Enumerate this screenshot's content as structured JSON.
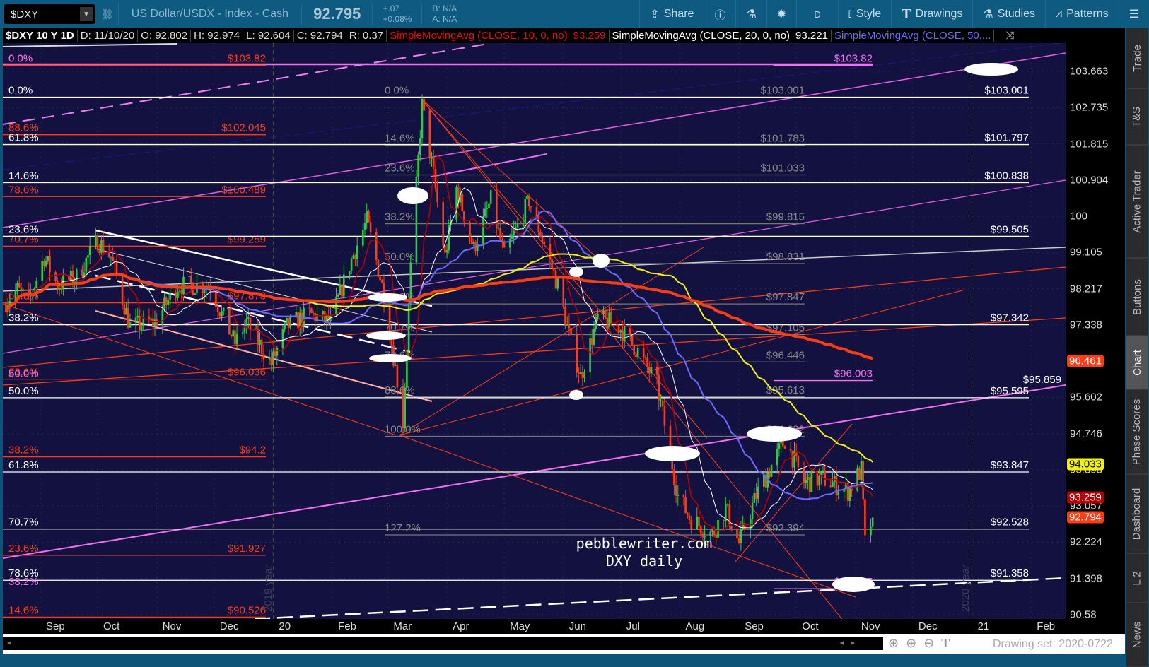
{
  "toolbar": {
    "symbol": "$DXY",
    "description": "US Dollar/USDX - Index - Cash",
    "last": "92.795",
    "change": "+.07",
    "change_pct": "+0.08%",
    "bid": "B: N/A",
    "ask": "A: N/A",
    "share": "Share",
    "interval": "D",
    "style": "Style",
    "drawings": "Drawings",
    "studies": "Studies",
    "patterns": "Patterns"
  },
  "infobar": {
    "title": "$DXY 10 Y 1D",
    "date": "D: 11/10/20",
    "open": "O: 92.802",
    "high": "H: 92.974",
    "low": "L: 92.604",
    "close": "C: 92.794",
    "range": "R: 0.37",
    "sma10": "SimpleMovingAvg (CLOSE, 10, 0, no)",
    "sma10_val": "93.259",
    "sma20": "SimpleMovingAvg (CLOSE, 20, 0, no)",
    "sma20_val": "93.221",
    "sma50": "SimpleMovingAvg (CLOSE, 50,..."
  },
  "sidebar": {
    "tabs": [
      "Trade",
      "T&S",
      "Active Trader",
      "Buttons",
      "Chart",
      "Phase Scores",
      "Dashboard",
      "L 2",
      "News"
    ],
    "active": "Chart"
  },
  "bottom": {
    "drawing_set": "Drawing set: 2020-0722"
  },
  "watermark": {
    "line1": "pebblewriter.com",
    "line2": "DXY daily",
    "year1": "2019 year",
    "year2": "2020 year"
  },
  "colors": {
    "up": "#2ecc40",
    "down": "#ff3d14",
    "sma10": "#b40000",
    "sma20": "#ffffff",
    "sma50": "#6b6bff",
    "sma100": "#f2f20a",
    "sma200": "#ff3d14",
    "bg": "#13113f"
  },
  "chart_data": {
    "type": "candlestick",
    "scale": "log",
    "ylim": [
      90.58,
      103.663
    ],
    "y_ticks": [
      "103.663",
      "102.735",
      "101.815",
      "100.904",
      "100",
      "99.105",
      "98.217",
      "97.338",
      "95.602",
      "94.746",
      "93.898",
      "93.057",
      "92.224",
      "91.398",
      "90.58"
    ],
    "x_ticks": [
      {
        "label": "Sep",
        "date": "2019-09-01"
      },
      {
        "label": "Oct",
        "date": "2019-10-01"
      },
      {
        "label": "Nov",
        "date": "2019-11-01"
      },
      {
        "label": "Dec",
        "date": "2019-12-01"
      },
      {
        "label": "20",
        "date": "2020-01-01"
      },
      {
        "label": "Feb",
        "date": "2020-02-01"
      },
      {
        "label": "Mar",
        "date": "2020-03-01"
      },
      {
        "label": "Apr",
        "date": "2020-04-01"
      },
      {
        "label": "May",
        "date": "2020-05-01"
      },
      {
        "label": "Jun",
        "date": "2020-06-01"
      },
      {
        "label": "Jul",
        "date": "2020-07-01"
      },
      {
        "label": "Aug",
        "date": "2020-08-01"
      },
      {
        "label": "Sep",
        "date": "2020-09-01"
      },
      {
        "label": "Oct",
        "date": "2020-10-01"
      },
      {
        "label": "Nov",
        "date": "2020-11-01"
      },
      {
        "label": "Dec",
        "date": "2020-12-01"
      },
      {
        "label": "21",
        "date": "2021-01-01"
      },
      {
        "label": "Feb",
        "date": "2021-02-01"
      }
    ],
    "price_tags": [
      {
        "value": "96.461",
        "color": "#ff3d14",
        "text": "#fff"
      },
      {
        "value": "94.033",
        "color": "#f2f20a",
        "text": "#000"
      },
      {
        "value": "93.259",
        "color": "#b40000",
        "text": "#fff"
      },
      {
        "value": "92.794",
        "color": "#ff3d14",
        "text": "#fff"
      }
    ],
    "close_keypoints": [
      [
        "2019-08-14",
        97.9
      ],
      [
        "2019-08-20",
        98.2
      ],
      [
        "2019-08-26",
        97.9
      ],
      [
        "2019-09-03",
        99.0
      ],
      [
        "2019-09-10",
        98.3
      ],
      [
        "2019-09-20",
        98.5
      ],
      [
        "2019-10-01",
        99.4
      ],
      [
        "2019-10-08",
        99.0
      ],
      [
        "2019-10-18",
        97.3
      ],
      [
        "2019-10-31",
        97.4
      ],
      [
        "2019-11-12",
        98.3
      ],
      [
        "2019-11-29",
        98.3
      ],
      [
        "2019-12-05",
        97.6
      ],
      [
        "2019-12-12",
        96.9
      ],
      [
        "2019-12-18",
        97.4
      ],
      [
        "2019-12-31",
        96.4
      ],
      [
        "2020-01-08",
        97.3
      ],
      [
        "2020-01-20",
        97.6
      ],
      [
        "2020-01-31",
        97.4
      ],
      [
        "2020-02-10",
        98.8
      ],
      [
        "2020-02-19",
        99.9
      ],
      [
        "2020-02-28",
        98.1
      ],
      [
        "2020-03-06",
        96.0
      ],
      [
        "2020-03-09",
        95.0
      ],
      [
        "2020-03-13",
        98.7
      ],
      [
        "2020-03-19",
        102.8
      ],
      [
        "2020-03-25",
        101.0
      ],
      [
        "2020-03-31",
        99.0
      ],
      [
        "2020-04-06",
        100.7
      ],
      [
        "2020-04-15",
        99.2
      ],
      [
        "2020-04-24",
        100.4
      ],
      [
        "2020-05-01",
        99.0
      ],
      [
        "2020-05-14",
        100.4
      ],
      [
        "2020-05-22",
        99.3
      ],
      [
        "2020-05-29",
        98.3
      ],
      [
        "2020-06-05",
        96.9
      ],
      [
        "2020-06-10",
        96.1
      ],
      [
        "2020-06-19",
        97.5
      ],
      [
        "2020-06-30",
        97.3
      ],
      [
        "2020-07-10",
        96.7
      ],
      [
        "2020-07-20",
        95.9
      ],
      [
        "2020-07-31",
        93.3
      ],
      [
        "2020-08-06",
        92.8
      ],
      [
        "2020-08-18",
        92.4
      ],
      [
        "2020-08-25",
        93.0
      ],
      [
        "2020-09-01",
        92.2
      ],
      [
        "2020-09-10",
        93.3
      ],
      [
        "2020-09-25",
        94.6
      ],
      [
        "2020-10-05",
        93.6
      ],
      [
        "2020-10-15",
        93.7
      ],
      [
        "2020-10-28",
        93.4
      ],
      [
        "2020-11-04",
        93.9
      ],
      [
        "2020-11-06",
        92.2
      ],
      [
        "2020-11-10",
        92.794
      ]
    ],
    "fib_white": [
      [
        "0.0%",
        "$103.001",
        103.001
      ],
      [
        "61.8%",
        "$101.797",
        101.797
      ],
      [
        "14.6%",
        "$100.838",
        100.838
      ],
      [
        "23.6%",
        "$99.505",
        99.505
      ],
      [
        "38.2%",
        "$97.342",
        97.342
      ],
      [
        "50.0%",
        "$95.595",
        95.595
      ],
      [
        "61.8%",
        "$93.847",
        93.847
      ],
      [
        "70.7%",
        "$92.528",
        92.528
      ],
      [
        "78.6%",
        "$91.358",
        91.358
      ]
    ],
    "fib_red": [
      [
        "0.0%",
        "$103.82",
        103.82
      ],
      [
        "88.6%",
        "$102.045",
        102.045
      ],
      [
        "78.6%",
        "$100.489",
        100.489
      ],
      [
        "70.7%",
        "$99.259",
        99.259
      ],
      [
        "61.8%",
        "$97.873",
        97.873
      ],
      [
        "23.6%",
        "$96.036",
        96.036
      ],
      [
        "38.2%",
        "$94.2",
        94.2
      ],
      [
        "23.6%",
        "$91.927",
        91.927
      ],
      [
        "14.6%",
        "$90.526",
        90.526
      ]
    ],
    "fib_grey": [
      [
        "0.0%",
        "$103.001",
        103.001
      ],
      [
        "14.6%",
        "$101.783",
        101.783
      ],
      [
        "23.6%",
        "$101.033",
        101.033
      ],
      [
        "38.2%",
        "$99.815",
        99.815
      ],
      [
        "50.0%",
        "$98.831",
        98.831
      ],
      [
        "61.8%",
        "$97.847",
        97.847
      ],
      [
        "70.7%",
        "$97.105",
        97.105
      ],
      [
        "78.6%",
        "$96.446",
        96.446
      ],
      [
        "88.6%",
        "$95.613",
        95.613
      ],
      [
        "100.0%",
        "$94.682",
        94.682
      ],
      [
        "127.2%",
        "$92.394",
        92.394
      ]
    ],
    "fib_pink": [
      [
        "0.0%",
        "$103.82",
        103.82
      ],
      [
        "50.0%",
        "$96.003",
        96.003
      ],
      [
        "38.2%",
        "$91.167",
        91.167
      ]
    ],
    "extra_labels": [
      {
        "text": "$95.859",
        "price": 95.859
      }
    ]
  }
}
